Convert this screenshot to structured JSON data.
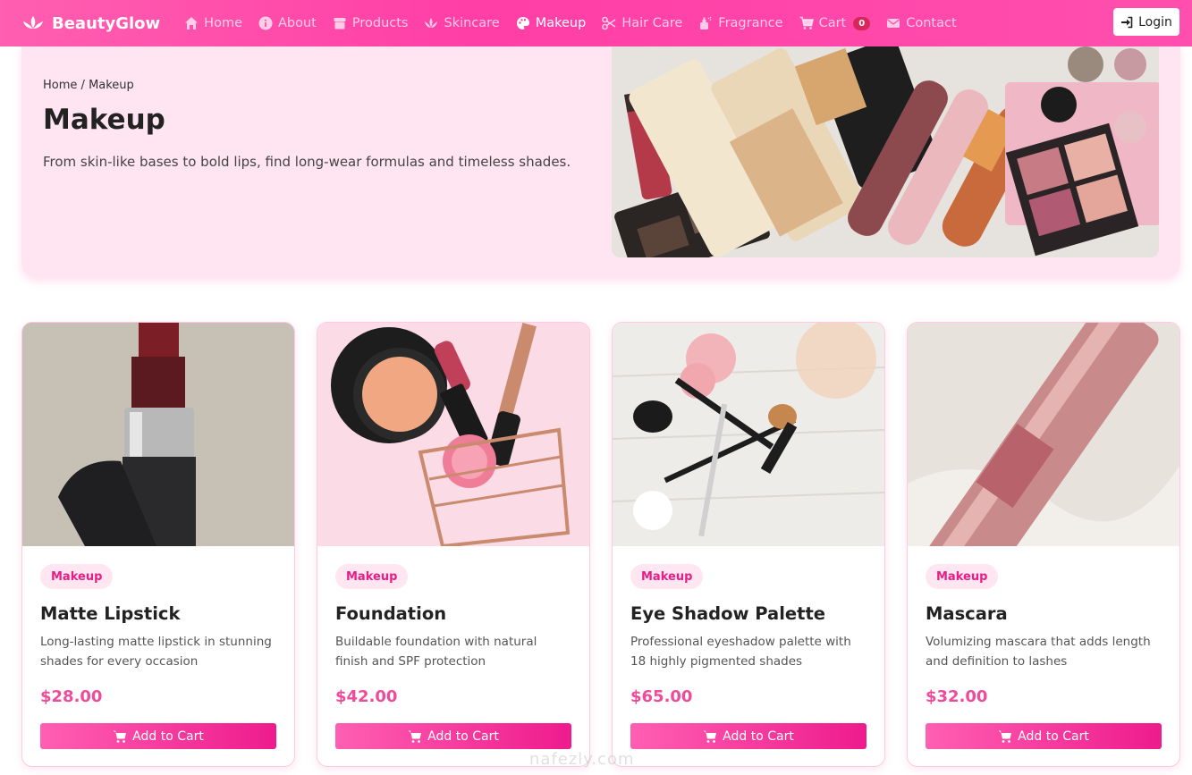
{
  "brand": {
    "name": "BeautyGlow"
  },
  "nav": {
    "items": [
      {
        "label": "Home",
        "icon": "home-icon",
        "active": false
      },
      {
        "label": "About",
        "icon": "info-icon",
        "active": false
      },
      {
        "label": "Products",
        "icon": "box-icon",
        "active": false
      },
      {
        "label": "Skincare",
        "icon": "spa-icon",
        "active": false
      },
      {
        "label": "Makeup",
        "icon": "palette-icon",
        "active": true
      },
      {
        "label": "Hair Care",
        "icon": "scissors-icon",
        "active": false
      },
      {
        "label": "Fragrance",
        "icon": "spray-icon",
        "active": false
      },
      {
        "label": "Cart",
        "icon": "cart-icon",
        "active": false
      },
      {
        "label": "Contact",
        "icon": "envelope-icon",
        "active": false
      }
    ],
    "cart_count": "0",
    "login_label": "Login"
  },
  "hero": {
    "breadcrumb_home": "Home",
    "breadcrumb_sep": "/",
    "breadcrumb_current": "Makeup",
    "title": "Makeup",
    "subtitle": "From skin-like bases to bold lips, find long-wear formulas and timeless shades."
  },
  "products": [
    {
      "tag": "Makeup",
      "title": "Matte Lipstick",
      "description": "Long-lasting matte lipstick in stunning shades for every occasion",
      "price": "$28.00",
      "button": "Add to Cart"
    },
    {
      "tag": "Makeup",
      "title": "Foundation",
      "description": "Buildable foundation with natural finish and SPF protection",
      "price": "$42.00",
      "button": "Add to Cart"
    },
    {
      "tag": "Makeup",
      "title": "Eye Shadow Palette",
      "description": "Professional eyeshadow palette with 18 highly pigmented shades",
      "price": "$65.00",
      "button": "Add to Cart"
    },
    {
      "tag": "Makeup",
      "title": "Mascara",
      "description": "Volumizing mascara that adds length and definition to lashes",
      "price": "$32.00",
      "button": "Add to Cart"
    }
  ],
  "colors": {
    "nav_bg": "#ff3ea6",
    "accent": "#ee1b8d",
    "price": "#ee4b9a",
    "hero_bg": "#ffe4f1"
  },
  "watermark": "nafezly.com"
}
